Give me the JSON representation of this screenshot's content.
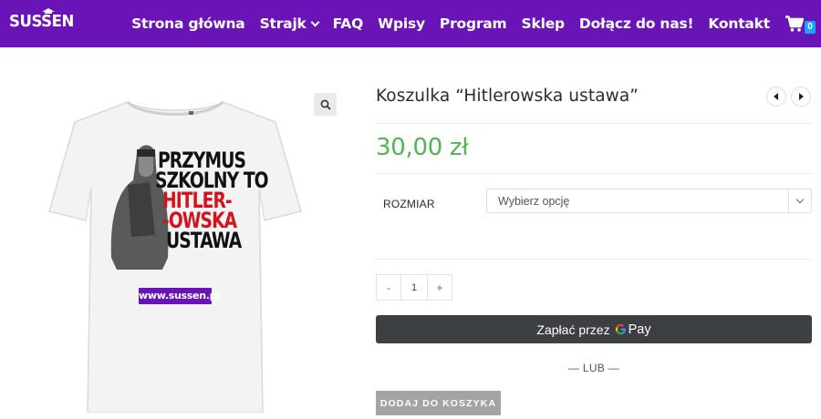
{
  "header": {
    "logo_text": "SUSSEN",
    "nav": [
      {
        "label": "Strona główna"
      },
      {
        "label": "Strajk",
        "has_dropdown": true
      },
      {
        "label": "FAQ"
      },
      {
        "label": "Wpisy"
      },
      {
        "label": "Program"
      },
      {
        "label": "Sklep"
      },
      {
        "label": "Dołącz do nas!"
      },
      {
        "label": "Kontakt"
      }
    ],
    "cart_count": "0",
    "bg_color": "#6a14b8"
  },
  "gallery": {
    "zoom_icon": "magnifier-icon",
    "shirt_print": {
      "lines": [
        "PRZYMUS",
        "SZKOLNY TO",
        "HITLER-",
        "-OWSKA",
        "USTAWA"
      ],
      "site": "www.sussen.pl"
    }
  },
  "product": {
    "title": "Koszulka “Hitlerowska ustawa”",
    "price": "30,00 zł",
    "price_color": "#52b455",
    "variation_label": "ROZMIAR",
    "variation_placeholder": "Wybierz opcję",
    "qty_minus": "-",
    "qty_value": "1",
    "qty_plus": "+",
    "gpay_label": "Zapłać przez",
    "gpay_brand": "Pay",
    "or_text": "— LUB —",
    "add_to_cart": "DODAJ DO KOSZYKA"
  }
}
